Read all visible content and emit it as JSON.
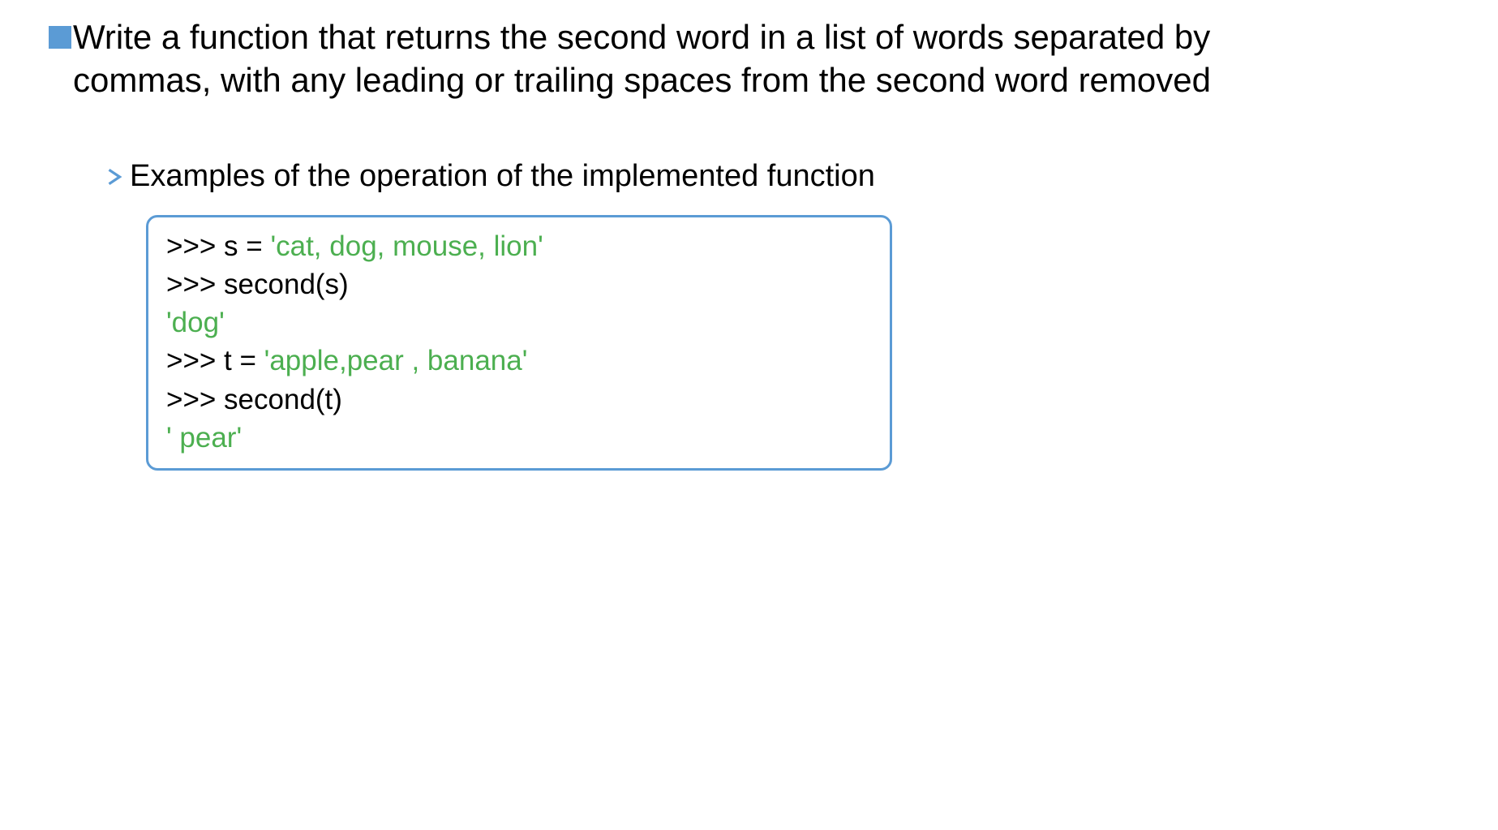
{
  "slide": {
    "main_text": "Write a function that returns the second word in a list of words separated by commas, with any leading or trailing spaces from the second word removed",
    "sub_heading": "Examples of the operation of the implemented function",
    "code": {
      "line1_prefix": ">>> s = ",
      "line1_string": "'cat, dog, mouse, lion'",
      "line2": ">>> second(s)",
      "line3_output": "'dog'",
      "line4_prefix": ">>> t = ",
      "line4_string": "'apple,pear , banana'",
      "line5": ">>> second(t)",
      "line6_output": "' pear'"
    }
  }
}
